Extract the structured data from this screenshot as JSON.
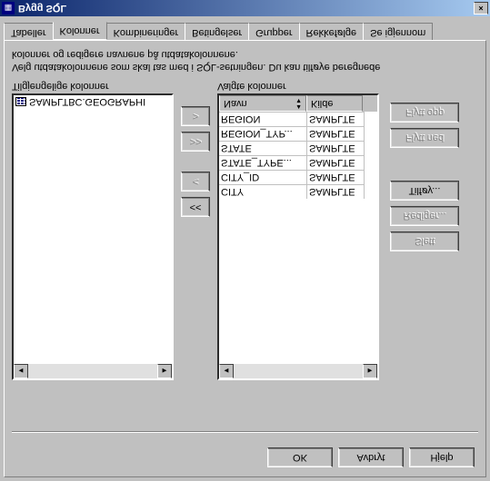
{
  "window": {
    "title": "Bygg SQL",
    "close": "×"
  },
  "tabs": {
    "items": [
      {
        "label": "Tabeller"
      },
      {
        "label": "Kolonner"
      },
      {
        "label": "Kombineringer"
      },
      {
        "label": "Betingelser"
      },
      {
        "label": "Grupper"
      },
      {
        "label": "Rekkefølge"
      },
      {
        "label": "Se igjennom"
      }
    ],
    "active": 1
  },
  "instructions": {
    "line1": "Velg utdatakolonnene som skal tas med i SQL-setningen.  Du kan tilføye beregnede",
    "line2": "kolonner og redigere navnene på utdatakolonnene."
  },
  "available": {
    "label": "Tilgjengelige kolonner",
    "items": [
      {
        "text": "SAMPLTBC.GEOGRAPHI"
      }
    ]
  },
  "selected": {
    "label": "Valgte kolonner",
    "headers": {
      "navn": "Navn",
      "kilde": "Kilde"
    },
    "rows": [
      {
        "navn": "REGION",
        "kilde": "SAMPLTE"
      },
      {
        "navn": "REGION_TYP...",
        "kilde": "SAMPLTE"
      },
      {
        "navn": "STATE",
        "kilde": "SAMPLTE"
      },
      {
        "navn": "STATE_TYPE...",
        "kilde": "SAMPLTE"
      },
      {
        "navn": "CITY_ID",
        "kilde": "SAMPLTE"
      },
      {
        "navn": "CITY",
        "kilde": "SAMPLTE"
      }
    ]
  },
  "transfer": {
    "add": ">",
    "addAll": ">>",
    "remove": "<",
    "removeAll": "<<"
  },
  "sidebuttons": {
    "moveUp": "Flytt opp",
    "moveDown": "Flytt ned",
    "add": "Tilføy...",
    "edit": "Rediger...",
    "delete": "Slett"
  },
  "footer": {
    "ok": "OK",
    "cancel": "Avbryt",
    "help": "Hjelp"
  }
}
